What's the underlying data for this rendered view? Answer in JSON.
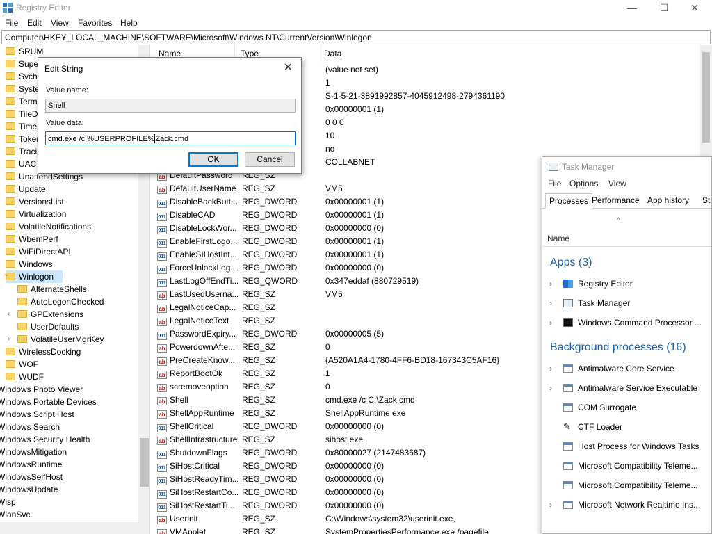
{
  "window": {
    "title": "Registry Editor",
    "controls": {
      "minimize": "—",
      "maximize": "☐",
      "close": "✕"
    }
  },
  "menu": [
    "File",
    "Edit",
    "View",
    "Favorites",
    "Help"
  ],
  "address": "Computer\\HKEY_LOCAL_MACHINE\\SOFTWARE\\Microsoft\\Windows NT\\CurrentVersion\\Winlogon",
  "tree": {
    "items": [
      {
        "label": "SRUM",
        "level": 1
      },
      {
        "label": "Supe",
        "level": 1
      },
      {
        "label": "Svcho",
        "level": 1
      },
      {
        "label": "Syste",
        "level": 1
      },
      {
        "label": "Termi",
        "level": 1
      },
      {
        "label": "TileD",
        "level": 1
      },
      {
        "label": "Time",
        "level": 1
      },
      {
        "label": "Toker",
        "level": 1
      },
      {
        "label": "Tracin",
        "level": 1
      },
      {
        "label": "UAC",
        "level": 1
      },
      {
        "label": "UnattendSettings",
        "level": 1
      },
      {
        "label": "Update",
        "level": 1
      },
      {
        "label": "VersionsList",
        "level": 1
      },
      {
        "label": "Virtualization",
        "level": 1
      },
      {
        "label": "VolatileNotifications",
        "level": 1
      },
      {
        "label": "WbemPerf",
        "level": 1
      },
      {
        "label": "WiFiDirectAPI",
        "level": 1
      },
      {
        "label": "Windows",
        "level": 1
      },
      {
        "label": "Winlogon",
        "level": 1,
        "selected": true,
        "expanded": true
      },
      {
        "label": "AlternateShells",
        "level": 2
      },
      {
        "label": "AutoLogonChecked",
        "level": 2
      },
      {
        "label": "GPExtensions",
        "level": 2,
        "expander": true
      },
      {
        "label": "UserDefaults",
        "level": 2
      },
      {
        "label": "VolatileUserMgrKey",
        "level": 2,
        "expander": true
      },
      {
        "label": "WirelessDocking",
        "level": 1
      },
      {
        "label": "WOF",
        "level": 1
      },
      {
        "label": "WUDF",
        "level": 1
      },
      {
        "label": "Windows Photo Viewer",
        "level": 0
      },
      {
        "label": "Windows Portable Devices",
        "level": 0
      },
      {
        "label": "Windows Script Host",
        "level": 0
      },
      {
        "label": "Windows Search",
        "level": 0
      },
      {
        "label": "Windows Security Health",
        "level": 0
      },
      {
        "label": "WindowsMitigation",
        "level": 0
      },
      {
        "label": "WindowsRuntime",
        "level": 0
      },
      {
        "label": "WindowsSelfHost",
        "level": 0
      },
      {
        "label": "WindowsUpdate",
        "level": 0
      },
      {
        "label": "Wisp",
        "level": 0
      },
      {
        "label": "WlanSvc",
        "level": 0
      }
    ]
  },
  "list": {
    "headers": {
      "name": "Name",
      "type": "Type",
      "data": "Data"
    },
    "rows": [
      {
        "name": "",
        "type": "",
        "data": "(value not set)",
        "icon": ""
      },
      {
        "name": "",
        "type": "",
        "data": "1",
        "icon": ""
      },
      {
        "name": "",
        "type": "",
        "data": "S-1-5-21-3891992857-4045912498-2794361190",
        "icon": ""
      },
      {
        "name": "",
        "type": "",
        "data": "0x00000001 (1)",
        "icon": ""
      },
      {
        "name": "",
        "type": "",
        "data": "0 0 0",
        "icon": ""
      },
      {
        "name": "",
        "type": "",
        "data": "10",
        "icon": ""
      },
      {
        "name": "",
        "type": "",
        "data": "no",
        "icon": ""
      },
      {
        "name": "",
        "type": "",
        "data": "COLLABNET",
        "icon": ""
      },
      {
        "name": "DefaultPassword",
        "type": "REG_SZ",
        "data": "",
        "icon": "ab"
      },
      {
        "name": "DefaultUserName",
        "type": "REG_SZ",
        "data": "VM5",
        "icon": "ab"
      },
      {
        "name": "DisableBackButt...",
        "type": "REG_DWORD",
        "data": "0x00000001 (1)",
        "icon": "bin"
      },
      {
        "name": "DisableCAD",
        "type": "REG_DWORD",
        "data": "0x00000001 (1)",
        "icon": "bin"
      },
      {
        "name": "DisableLockWor...",
        "type": "REG_DWORD",
        "data": "0x00000000 (0)",
        "icon": "bin"
      },
      {
        "name": "EnableFirstLogo...",
        "type": "REG_DWORD",
        "data": "0x00000001 (1)",
        "icon": "bin"
      },
      {
        "name": "EnableSIHostInt...",
        "type": "REG_DWORD",
        "data": "0x00000001 (1)",
        "icon": "bin"
      },
      {
        "name": "ForceUnlockLog...",
        "type": "REG_DWORD",
        "data": "0x00000000 (0)",
        "icon": "bin"
      },
      {
        "name": "LastLogOffEndTi...",
        "type": "REG_QWORD",
        "data": "0x347eddaf (880729519)",
        "icon": "bin"
      },
      {
        "name": "LastUsedUserna...",
        "type": "REG_SZ",
        "data": "VM5",
        "icon": "ab"
      },
      {
        "name": "LegalNoticeCap...",
        "type": "REG_SZ",
        "data": "",
        "icon": "ab"
      },
      {
        "name": "LegalNoticeText",
        "type": "REG_SZ",
        "data": "",
        "icon": "ab"
      },
      {
        "name": "PasswordExpiry...",
        "type": "REG_DWORD",
        "data": "0x00000005 (5)",
        "icon": "bin"
      },
      {
        "name": "PowerdownAfte...",
        "type": "REG_SZ",
        "data": "0",
        "icon": "ab"
      },
      {
        "name": "PreCreateKnow...",
        "type": "REG_SZ",
        "data": "{A520A1A4-1780-4FF6-BD18-167343C5AF16}",
        "icon": "ab"
      },
      {
        "name": "ReportBootOk",
        "type": "REG_SZ",
        "data": "1",
        "icon": "ab"
      },
      {
        "name": "scremoveoption",
        "type": "REG_SZ",
        "data": "0",
        "icon": "ab"
      },
      {
        "name": "Shell",
        "type": "REG_SZ",
        "data": "cmd.exe /c C:\\Zack.cmd",
        "icon": "ab"
      },
      {
        "name": "ShellAppRuntime",
        "type": "REG_SZ",
        "data": "ShellAppRuntime.exe",
        "icon": "ab"
      },
      {
        "name": "ShellCritical",
        "type": "REG_DWORD",
        "data": "0x00000000 (0)",
        "icon": "bin"
      },
      {
        "name": "ShellInfrastructure",
        "type": "REG_SZ",
        "data": "sihost.exe",
        "icon": "ab"
      },
      {
        "name": "ShutdownFlags",
        "type": "REG_DWORD",
        "data": "0x80000027 (2147483687)",
        "icon": "bin"
      },
      {
        "name": "SiHostCritical",
        "type": "REG_DWORD",
        "data": "0x00000000 (0)",
        "icon": "bin"
      },
      {
        "name": "SiHostReadyTim...",
        "type": "REG_DWORD",
        "data": "0x00000000 (0)",
        "icon": "bin"
      },
      {
        "name": "SiHostRestartCo...",
        "type": "REG_DWORD",
        "data": "0x00000000 (0)",
        "icon": "bin"
      },
      {
        "name": "SiHostRestartTi...",
        "type": "REG_DWORD",
        "data": "0x00000000 (0)",
        "icon": "bin"
      },
      {
        "name": "Userinit",
        "type": "REG_SZ",
        "data": "C:\\Windows\\system32\\userinit.exe,",
        "icon": "ab"
      },
      {
        "name": "VMApplet",
        "type": "REG_SZ",
        "data": "SystemPropertiesPerformance.exe /pagefile",
        "icon": "ab"
      }
    ]
  },
  "dialog": {
    "title": "Edit String",
    "close": "✕",
    "value_name_label": "Value name:",
    "value_name": "Shell",
    "value_data_label": "Value data:",
    "value_data_before_caret": "cmd.exe /c %USERPROFILE%",
    "value_data_after_caret": "Zack.cmd",
    "ok": "OK",
    "cancel": "Cancel"
  },
  "taskmanager": {
    "title": "Task Manager",
    "menu": [
      "File",
      "Options",
      "View"
    ],
    "tabs": [
      "Processes",
      "Performance",
      "App history",
      "Star"
    ],
    "active_tab": "Processes",
    "sort_arrow": "^",
    "name_col": "Name",
    "apps_group": "Apps (3)",
    "apps": [
      {
        "name": "Registry Editor",
        "expander": true,
        "icon": "registry-icon"
      },
      {
        "name": "Task Manager",
        "expander": true,
        "icon": "taskmanager-icon"
      },
      {
        "name": "Windows Command Processor ...",
        "expander": true,
        "icon": "cmd-icon"
      }
    ],
    "bg_group": "Background processes (16)",
    "background": [
      {
        "name": "Antimalware Core Service",
        "expander": true,
        "icon": "service-icon"
      },
      {
        "name": "Antimalware Service Executable",
        "expander": true,
        "icon": "service-icon"
      },
      {
        "name": "COM Surrogate",
        "expander": false,
        "icon": "service-icon"
      },
      {
        "name": "CTF Loader",
        "expander": false,
        "icon": "pen-icon"
      },
      {
        "name": "Host Process for Windows Tasks",
        "expander": false,
        "icon": "service-icon"
      },
      {
        "name": "Microsoft Compatibility Teleme...",
        "expander": false,
        "icon": "service-icon"
      },
      {
        "name": "Microsoft Compatibility Teleme...",
        "expander": false,
        "icon": "service-icon"
      },
      {
        "name": "Microsoft Network Realtime Ins...",
        "expander": true,
        "icon": "service-icon"
      }
    ]
  },
  "colors": {
    "accent": "#0078d7",
    "selection": "#cce8ff",
    "group_text": "#1a5fa8",
    "folder": "#f4d468"
  }
}
